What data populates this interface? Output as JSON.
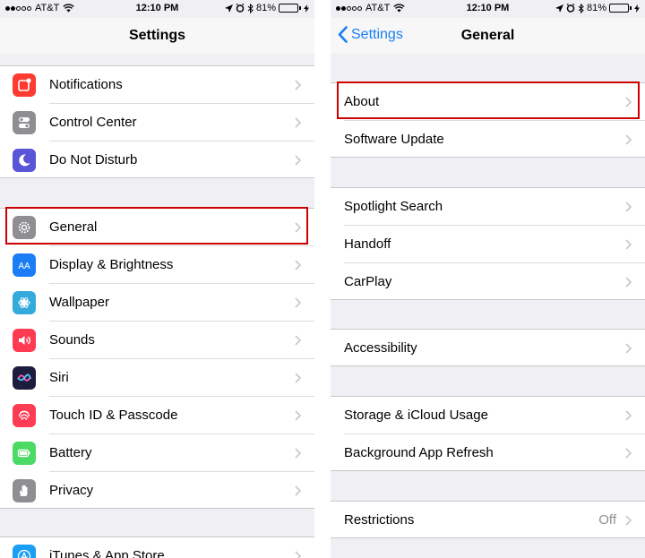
{
  "status_bar": {
    "carrier": "AT&T",
    "time": "12:10 PM",
    "battery": "81%",
    "battery_fraction": 0.81,
    "battery_color": "#4cd964"
  },
  "left_screen": {
    "title": "Settings",
    "groups": [
      [
        {
          "label": "Notifications",
          "icon": "notifications-icon",
          "color": "#fd3b30"
        },
        {
          "label": "Control Center",
          "icon": "control-center-icon",
          "color": "#8e8e93"
        },
        {
          "label": "Do Not Disturb",
          "icon": "moon-icon",
          "color": "#5856d6"
        }
      ],
      [
        {
          "label": "General",
          "icon": "gear-icon",
          "color": "#8e8e93",
          "highlighted": true
        },
        {
          "label": "Display & Brightness",
          "icon": "display-icon",
          "color": "#1a7df6"
        },
        {
          "label": "Wallpaper",
          "icon": "wallpaper-icon",
          "color": "#35aadc"
        },
        {
          "label": "Sounds",
          "icon": "speaker-icon",
          "color": "#fd3b52"
        },
        {
          "label": "Siri",
          "icon": "siri-icon",
          "color": "#1c1c3c"
        },
        {
          "label": "Touch ID & Passcode",
          "icon": "fingerprint-icon",
          "color": "#fd3b52"
        },
        {
          "label": "Battery",
          "icon": "battery-icon",
          "color": "#4cd964"
        },
        {
          "label": "Privacy",
          "icon": "hand-icon",
          "color": "#8e8e93"
        }
      ],
      [
        {
          "label": "iTunes & App Store",
          "icon": "app-store-icon",
          "color": "#1a9ff5"
        }
      ]
    ]
  },
  "right_screen": {
    "back_label": "Settings",
    "title": "General",
    "groups": [
      [
        {
          "label": "About",
          "highlighted": true
        },
        {
          "label": "Software Update"
        }
      ],
      [
        {
          "label": "Spotlight Search"
        },
        {
          "label": "Handoff"
        },
        {
          "label": "CarPlay"
        }
      ],
      [
        {
          "label": "Accessibility"
        }
      ],
      [
        {
          "label": "Storage & iCloud Usage"
        },
        {
          "label": "Background App Refresh"
        }
      ],
      [
        {
          "label": "Restrictions",
          "value": "Off"
        }
      ]
    ]
  },
  "colors": {
    "highlight": "#cc0000",
    "accent": "#1a7df6"
  }
}
